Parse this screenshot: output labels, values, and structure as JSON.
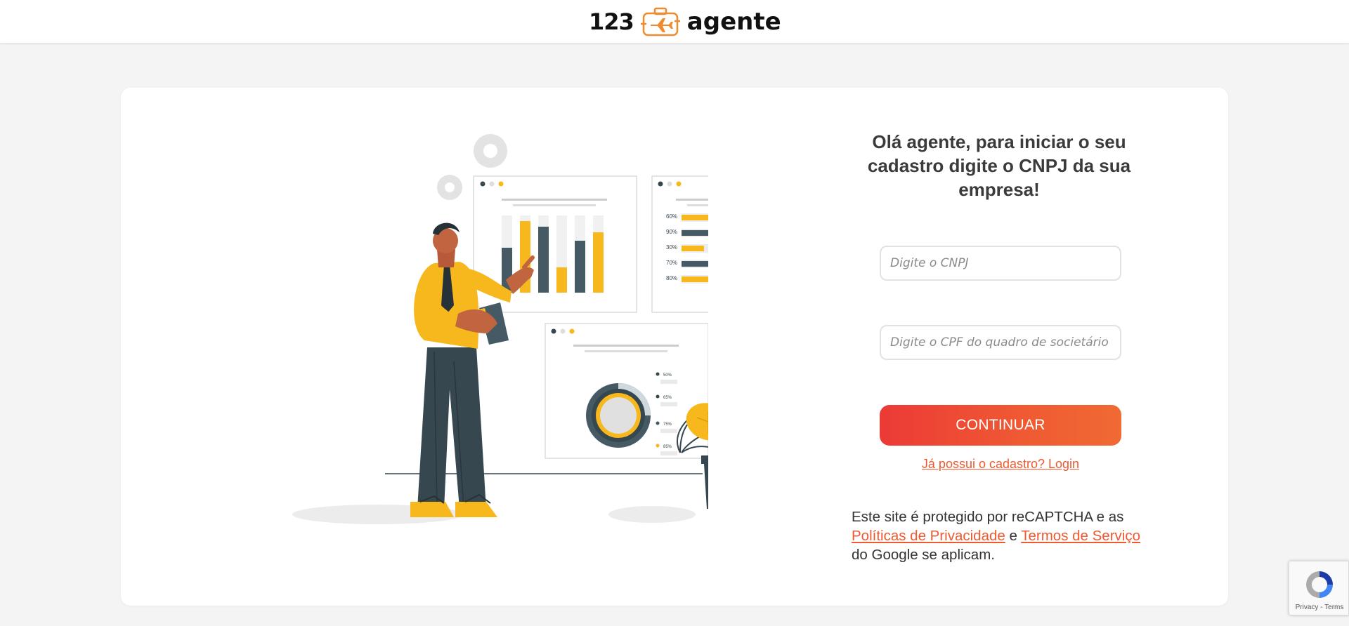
{
  "header": {
    "logo_number": "123",
    "logo_word": "agente",
    "logo_icon": "suitcase-airplane-icon"
  },
  "illustration": {
    "description_icon": "presenter-with-charts-illustration",
    "bar_labels": [
      "60%",
      "90%",
      "30%",
      "70%",
      "80%"
    ],
    "donut_labels": [
      "50%",
      "65%",
      "75%",
      "85%"
    ]
  },
  "form": {
    "headline": "Olá agente, para iniciar o seu cadastro digite o CNPJ da sua empresa!",
    "cnpj_placeholder": "Digite o CNPJ",
    "cpf_placeholder": "Digite o CPF do quadro de societário",
    "continue_label": "CONTINUAR",
    "login_link": "Já possui o cadastro? Login"
  },
  "recaptcha_note": {
    "prefix": "Este site é protegido por reCAPTCHA e as",
    "privacy": "Políticas de Privacidade",
    "conjunction": "e",
    "terms": "Termos de Serviço",
    "suffix": "do Google se aplicam."
  },
  "recaptcha_badge": {
    "privacy": "Privacy",
    "separator": "-",
    "terms": "Terms"
  },
  "colors": {
    "accent": "#ee5a2f",
    "button_start": "#ec3a36",
    "button_end": "#f06a33",
    "illustration_yellow": "#f7b81e",
    "illustration_dark": "#37474f",
    "background": "#f5f4f5"
  }
}
